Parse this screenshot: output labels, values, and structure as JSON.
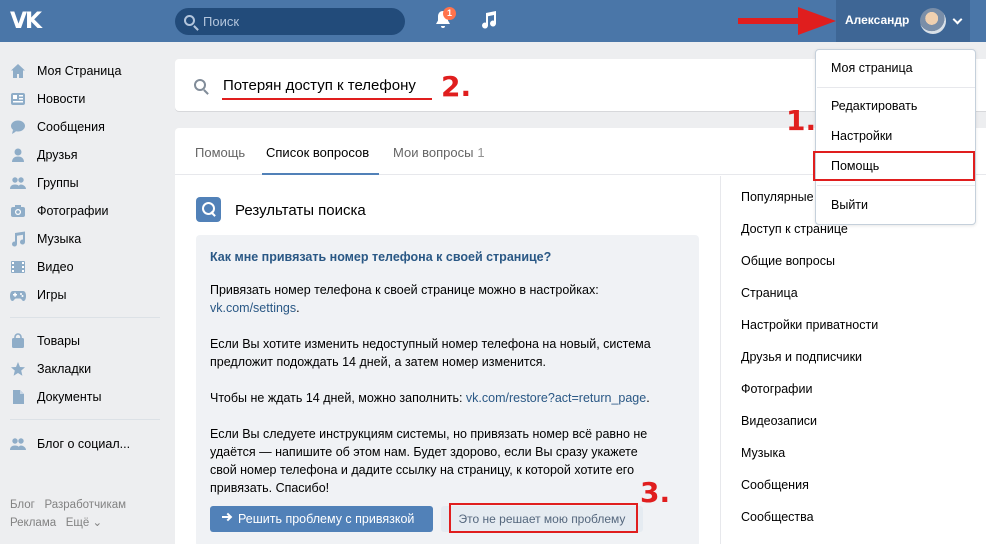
{
  "header": {
    "logo": "VK",
    "search_placeholder": "Поиск",
    "notifications_count": "1",
    "profile_name": "Александр"
  },
  "sidebar": {
    "items": [
      {
        "label": "Моя Страница",
        "icon": "home-icon"
      },
      {
        "label": "Новости",
        "icon": "news-icon"
      },
      {
        "label": "Сообщения",
        "icon": "messages-icon"
      },
      {
        "label": "Друзья",
        "icon": "friends-icon"
      },
      {
        "label": "Группы",
        "icon": "groups-icon"
      },
      {
        "label": "Фотографии",
        "icon": "camera-icon"
      },
      {
        "label": "Музыка",
        "icon": "music-icon"
      },
      {
        "label": "Видео",
        "icon": "video-icon"
      },
      {
        "label": "Игры",
        "icon": "games-icon"
      },
      {
        "label": "Товары",
        "icon": "bag-icon"
      },
      {
        "label": "Закладки",
        "icon": "star-icon"
      },
      {
        "label": "Документы",
        "icon": "document-icon"
      },
      {
        "label": "Блог о социал...",
        "icon": "community-icon"
      }
    ],
    "footer": {
      "blog": "Блог",
      "developers": "Разработчикам",
      "ads": "Реклама",
      "more": "Ещё"
    }
  },
  "help_search": {
    "query": "Потерян доступ к телефону"
  },
  "tabs": [
    {
      "label": "Помощь"
    },
    {
      "label": "Список вопросов"
    },
    {
      "label": "Мои вопросы",
      "count": "1"
    }
  ],
  "results": {
    "title": "Результаты поиска",
    "question": "Как мне привязать номер телефона к своей странице?",
    "p1": "Привязать номер телефона к своей странице можно в настройках:",
    "p1_link": "vk.com/settings",
    "p1_end": ".",
    "p2_line1": "Если Вы хотите изменить недоступный номер телефона на новый, система",
    "p2_line2": "предложит подождать 14 дней, а затем номер изменится.",
    "p3": "Чтобы не ждать 14 дней, можно заполнить: ",
    "p3_link": "vk.com/restore?act=return_page",
    "p3_end": ".",
    "p4_line1": "Если Вы следуете инструкциям системы, но привязать номер всё равно не",
    "p4_line2": "удаётся — напишите об этом нам. Будет здорово, если Вы сразу укажете",
    "p4_line3": "свой номер телефона и дадите ссылку на страницу, к которой хотите его",
    "p4_line4": "привязать. Спасибо!",
    "solve_button": "Решить проблему с привязкой",
    "not_solved_button": "Это не решает мою проблему"
  },
  "help_nav": [
    "Популярные",
    "Доступ к странице",
    "Общие вопросы",
    "Страница",
    "Настройки приватности",
    "Друзья и подписчики",
    "Фотографии",
    "Видеозаписи",
    "Музыка",
    "Сообщения",
    "Сообщества"
  ],
  "dropdown": {
    "my_page": "Моя страница",
    "edit": "Редактировать",
    "settings": "Настройки",
    "help": "Помощь",
    "logout": "Выйти"
  },
  "annotations": {
    "step1": "1.",
    "step2": "2.",
    "step3": "3."
  },
  "colors": {
    "header_bg": "#4a76a8",
    "accent": "#5181b8",
    "link": "#2a5885",
    "annotation_red": "#e01e1e"
  }
}
